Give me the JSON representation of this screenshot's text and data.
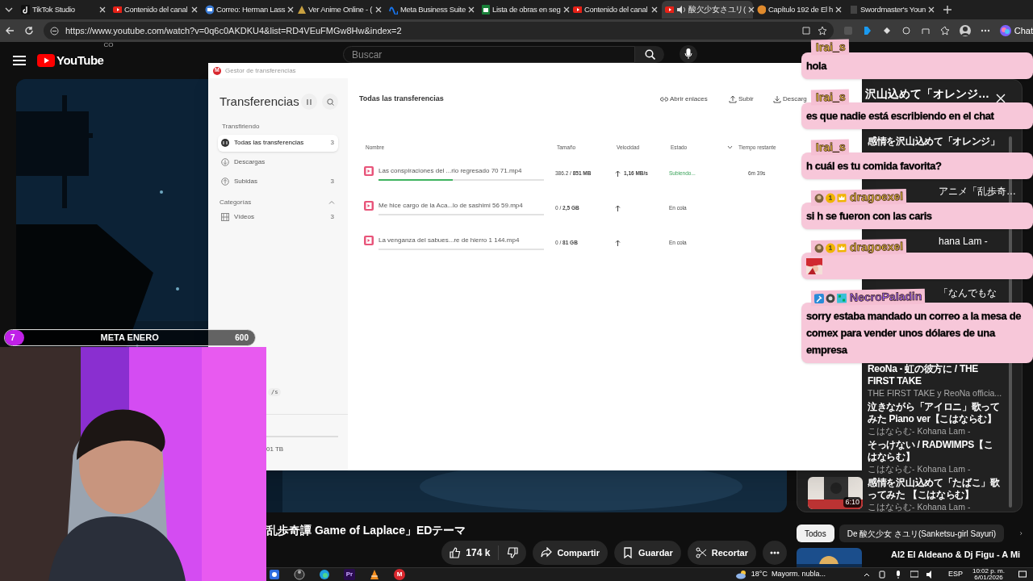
{
  "browser": {
    "tabs": [
      {
        "label": "TikTok Studio",
        "selected": false,
        "audio": false
      },
      {
        "label": "Contenido del canal",
        "selected": false,
        "audio": false
      },
      {
        "label": "Correo: Herman Lass",
        "selected": false,
        "audio": false
      },
      {
        "label": "Ver Anime Online - (",
        "selected": false,
        "audio": false
      },
      {
        "label": "Meta Business Suite",
        "selected": false,
        "audio": false
      },
      {
        "label": "Lista de obras en seg",
        "selected": false,
        "audio": false
      },
      {
        "label": "Contenido del canal",
        "selected": false,
        "audio": false
      },
      {
        "label": "酸欠少女さユリ(",
        "selected": true,
        "audio": true
      },
      {
        "label": "Capítulo 192 de El h",
        "selected": false,
        "audio": false
      },
      {
        "label": "Swordmaster's Youn",
        "selected": false,
        "audio": false
      }
    ],
    "address": "https://www.youtube.com/watch?v=0q6c0AKDKU4&list=RD4VEuFMGw8Hw&index=2",
    "chat_button": "Chat"
  },
  "youtube": {
    "logo": "YouTube",
    "country": "CO",
    "search": {
      "placeholder": "Buscar"
    },
    "video": {
      "title": "乱歩奇譚 Game of Laplace」EDテーマ",
      "likes": "174 k",
      "actions": [
        "Compartir",
        "Guardar",
        "Recortar"
      ]
    },
    "playlist": {
      "title": "沢山込めて「オレンジ…",
      "items": [
        {
          "lines": [
            {
              "kind": "title",
              "text": "感情を沢山込めて「オレンジ」"
            },
            {
              "kind": "gap"
            },
            {
              "kind": "gap"
            }
          ]
        },
        {
          "lines": [
            {
              "kind": "gap"
            },
            {
              "kind": "tail",
              "text": "アニメ「乱歩奇…"
            },
            {
              "kind": "gap"
            }
          ]
        },
        {
          "lines": [
            {
              "kind": "gap"
            },
            {
              "kind": "gap"
            },
            {
              "kind": "tail",
              "text": "hana Lam -"
            }
          ]
        },
        {
          "lines": [
            {
              "kind": "gap"
            },
            {
              "kind": "gap"
            },
            {
              "kind": "gap"
            }
          ]
        },
        {
          "lines": [
            {
              "kind": "tail",
              "text": "「なんでもな"
            },
            {
              "kind": "gap"
            },
            {
              "kind": "gap"
            }
          ]
        },
        {
          "lines": [
            {
              "kind": "gap"
            },
            {
              "kind": "gap"
            },
            {
              "kind": "gap"
            }
          ]
        },
        {
          "lines": [
            {
              "kind": "title",
              "text": "ReoNa - 虹の彼方に / THE"
            },
            {
              "kind": "title",
              "text": "FIRST TAKE"
            },
            {
              "kind": "channel",
              "text": "THE FIRST TAKE y ReoNa officia..."
            }
          ]
        },
        {
          "lines": [
            {
              "kind": "title",
              "text": "泣きながら「アイロニ」歌って"
            },
            {
              "kind": "title",
              "text": "みた Piano ver【こはならむ】"
            },
            {
              "kind": "channel",
              "text": "こはならむ- Kohana Lam -"
            }
          ]
        },
        {
          "lines": [
            {
              "kind": "title",
              "text": "そっけない / RADWIMPS【こ"
            },
            {
              "kind": "title",
              "text": "はならむ】"
            },
            {
              "kind": "channel",
              "text": "こはならむ- Kohana Lam -"
            }
          ]
        },
        {
          "lines": [
            {
              "kind": "title",
              "text": "感情を沢山込めて「たばこ」歌"
            },
            {
              "kind": "title",
              "text": "ってみた 【こはならむ】"
            },
            {
              "kind": "channel",
              "text": "こはならむ- Kohana Lam -"
            }
          ],
          "duration": "6:10"
        }
      ]
    },
    "chips": [
      {
        "label": "Todos",
        "selected": true
      },
      {
        "label": "De 酸欠少女 さユリ(Sanketsu-girl Sayuri)",
        "selected": false
      }
    ],
    "next_video": {
      "title": "Al2 El Aldeano & Dj Figu - A Mi"
    }
  },
  "transfer_window": {
    "logo": "M",
    "title": "Gestor de transferencias",
    "heading": "Transferencias",
    "section": "Transfiriendo",
    "nav": [
      {
        "label": "Todas las transferencias",
        "count": "3",
        "selected": true
      },
      {
        "label": "Descargas",
        "selected": false
      },
      {
        "label": "Subidas",
        "count": "3",
        "selected": false
      }
    ],
    "categories": {
      "title": "Categorías",
      "expanded": true,
      "items": [
        {
          "label": "Vídeos",
          "count": "3"
        }
      ]
    },
    "footer": {
      "speed": "/s",
      "storage": "01 TB"
    },
    "main_heading": "Todas las transferencias",
    "actions": [
      "Abrir enlaces",
      "Subir",
      "Descarg"
    ],
    "columns": [
      "Nombre",
      "Tamaño",
      "Velocidad",
      "Estado",
      "Tiempo restante"
    ],
    "rows": [
      {
        "name": "Las conspiraciones del ...rio regresado 70 71.mp4",
        "level": 0.45,
        "size": "386.2 / **851 MB**",
        "speed": "1,16 MB/s",
        "status": "Subiendo...",
        "kind": "active",
        "time": "6m 39s"
      },
      {
        "name": "Me hice cargo de la Aca...lo de sashimi 56 59.mp4",
        "level": 0,
        "size": "0 / **2,5 GB**",
        "status": "En cola",
        "kind": "queued"
      },
      {
        "name": "La venganza del sabues...re de hierro 1 144.mp4",
        "level": 0,
        "size": "0 / **81 GB**",
        "status": "En cola",
        "kind": "queued"
      }
    ]
  },
  "chat": [
    {
      "user": "Irai_s",
      "color": "#f5c542",
      "kind": "text",
      "text": "hola"
    },
    {
      "user": "Irai_s",
      "color": "#f5c542",
      "kind": "text",
      "text": "es que nadie está escribiendo en el chat"
    },
    {
      "user": "Irai_s",
      "color": "#f5c542",
      "kind": "text",
      "text": "h cuál es tu comida favorita?"
    },
    {
      "user": "dragoexel",
      "color": "#f5c542",
      "badges": [
        {
          "kind": "avatar"
        },
        {
          "kind": "level",
          "text": "1"
        },
        {
          "kind": "crown"
        }
      ],
      "kind": "text",
      "text": "si h se fueron con las caris"
    },
    {
      "user": "dragoexel",
      "color": "#f5c542",
      "badges": [
        {
          "kind": "avatar"
        },
        {
          "kind": "level",
          "text": "1"
        },
        {
          "kind": "crown"
        }
      ],
      "kind": "emote"
    },
    {
      "user": "NecroPaladin",
      "color": "#9b5cf6",
      "badges": [
        {
          "kind": "hammer"
        },
        {
          "kind": "eye"
        },
        {
          "kind": "pixel"
        }
      ],
      "kind": "text",
      "text": "sorry estaba mandado un correo a la mesa de comex para vender unos dólares de una empresa"
    }
  ],
  "goal": {
    "count": "7",
    "label": "META ENERO",
    "target": "600"
  },
  "taskbar": {
    "apps": [
      {
        "kind": "tool"
      },
      {
        "kind": "obs"
      },
      {
        "kind": "edge"
      },
      {
        "kind": "premiere",
        "text": "Pr"
      },
      {
        "kind": "vlc"
      },
      {
        "kind": "mega",
        "text": "M"
      }
    ],
    "weather": {
      "temp": "18°C",
      "text": "Mayorm. nubla..."
    },
    "language": "ESP",
    "time": "10:02 p. m.",
    "date": "6/01/2026"
  }
}
